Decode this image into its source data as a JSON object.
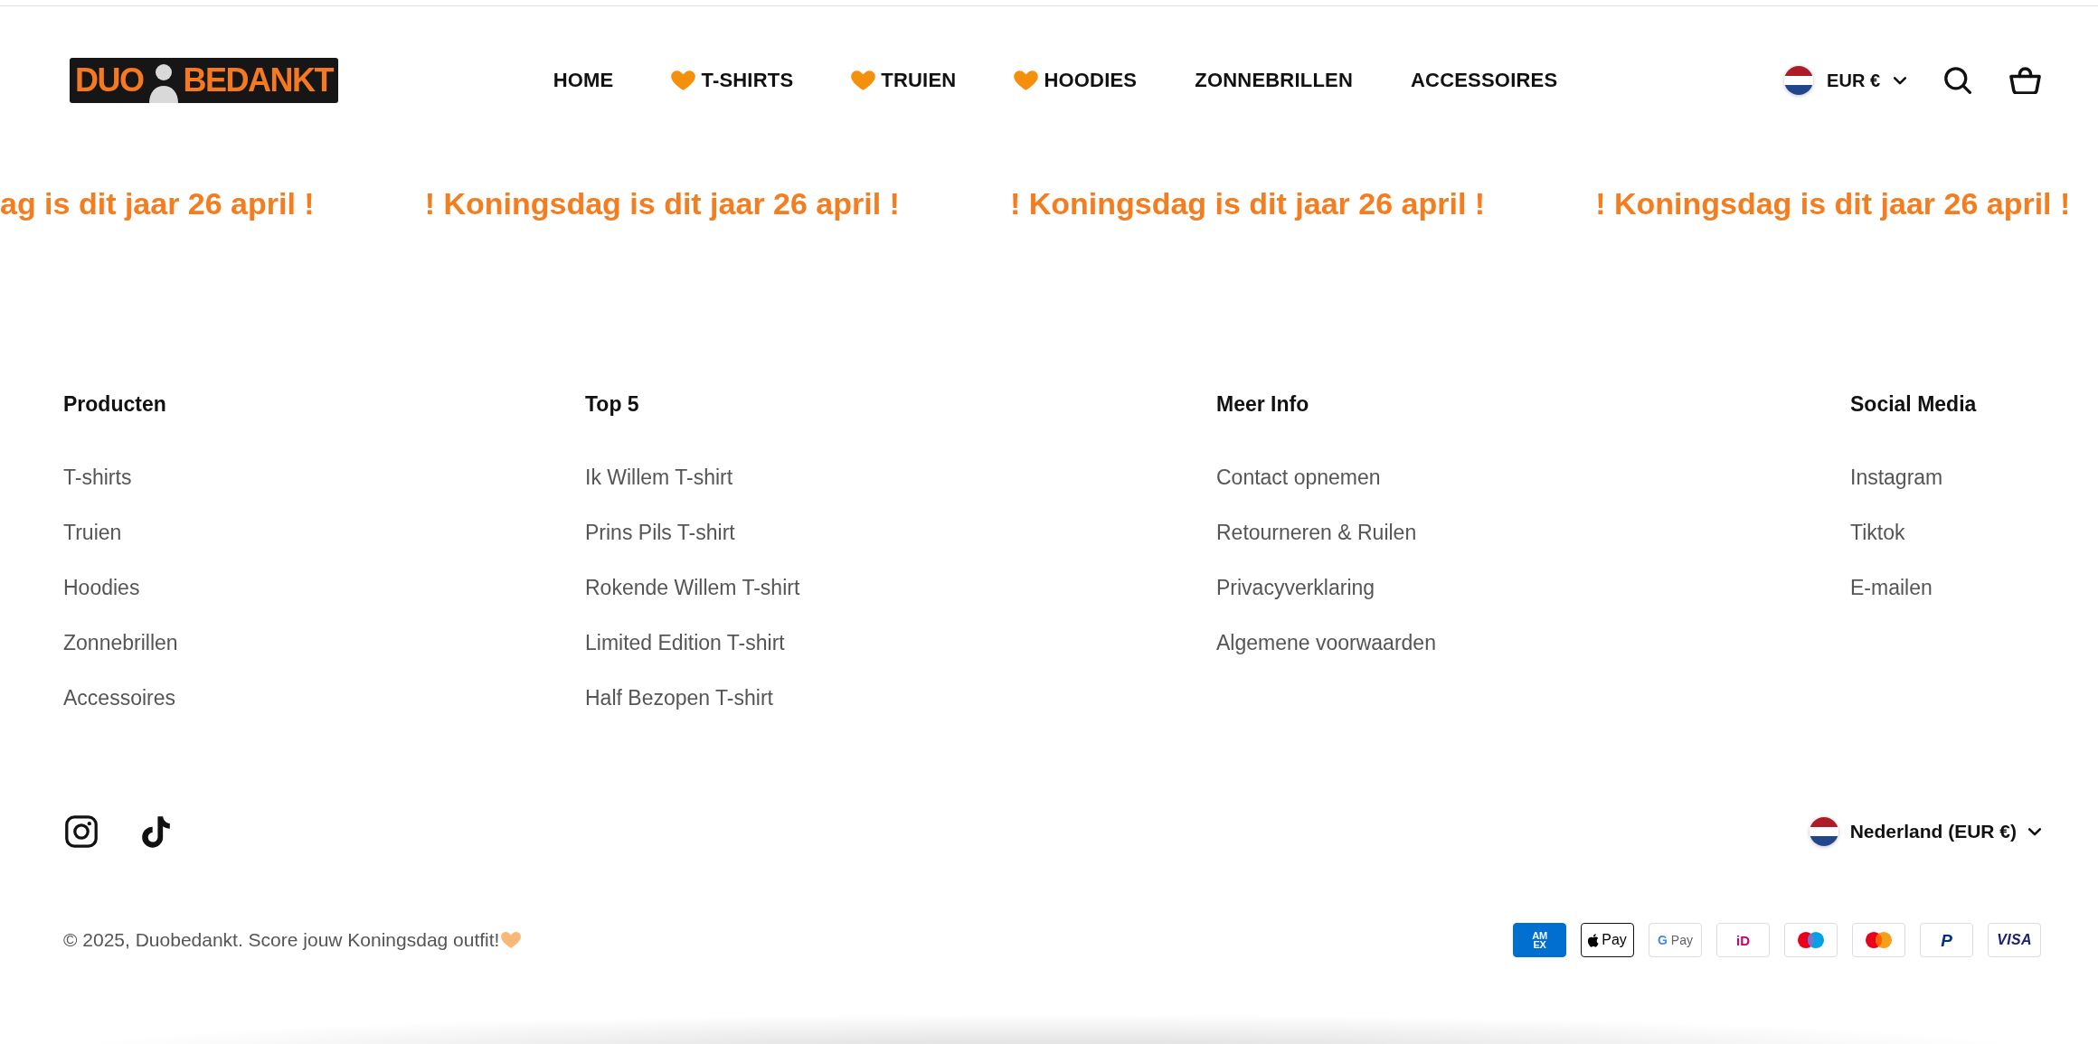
{
  "header": {
    "logo": {
      "left_text": "DUO",
      "right_text": "BEDANKT"
    },
    "nav": [
      {
        "label": "HOME",
        "kind": "plain"
      },
      {
        "label": "T-SHIRTS",
        "kind": "heart"
      },
      {
        "label": "TRUIEN",
        "kind": "heart"
      },
      {
        "label": "HOODIES",
        "kind": "heart"
      },
      {
        "label": "ZONNEBRILLEN",
        "kind": "plain"
      },
      {
        "label": "ACCESSOIRES",
        "kind": "plain"
      }
    ],
    "currency": {
      "label": "EUR €"
    }
  },
  "announcement": {
    "items": [
      "ag is dit jaar 26 april !",
      "! Koningsdag is dit jaar 26 april !",
      "! Koningsdag is dit jaar 26 april !",
      "! Koningsdag is dit jaar 26 april !"
    ]
  },
  "footer": {
    "columns": [
      {
        "heading": "Producten",
        "links": [
          "T-shirts",
          "Truien",
          "Hoodies",
          "Zonnebrillen",
          "Accessoires"
        ]
      },
      {
        "heading": "Top 5",
        "links": [
          "Ik Willem T-shirt",
          "Prins Pils T-shirt",
          "Rokende Willem T-shirt",
          "Limited Edition T-shirt",
          "Half Bezopen T-shirt"
        ]
      },
      {
        "heading": "Meer Info",
        "links": [
          "Contact opnemen",
          "Retourneren & Ruilen",
          "Privacyverklaring",
          "Algemene voorwaarden"
        ]
      },
      {
        "heading": "Social Media",
        "links": [
          "Instagram",
          "Tiktok",
          "E-mailen"
        ]
      }
    ],
    "social_icons": [
      {
        "kind": "instagram"
      },
      {
        "kind": "tiktok"
      }
    ],
    "country_selector": {
      "label": "Nederland (EUR €)"
    },
    "copyright": "© 2025, Duobedankt. Score jouw Koningsdag outfit!",
    "payment_methods": [
      {
        "kind": "amex",
        "label": "AM EX"
      },
      {
        "kind": "apple-pay",
        "label": "Pay"
      },
      {
        "kind": "google-pay",
        "letter": "G",
        "label": "Pay"
      },
      {
        "kind": "ideal",
        "label": "iD"
      },
      {
        "kind": "maestro"
      },
      {
        "kind": "mastercard"
      },
      {
        "kind": "paypal",
        "label": "P"
      },
      {
        "kind": "visa",
        "label": "VISA"
      }
    ]
  }
}
